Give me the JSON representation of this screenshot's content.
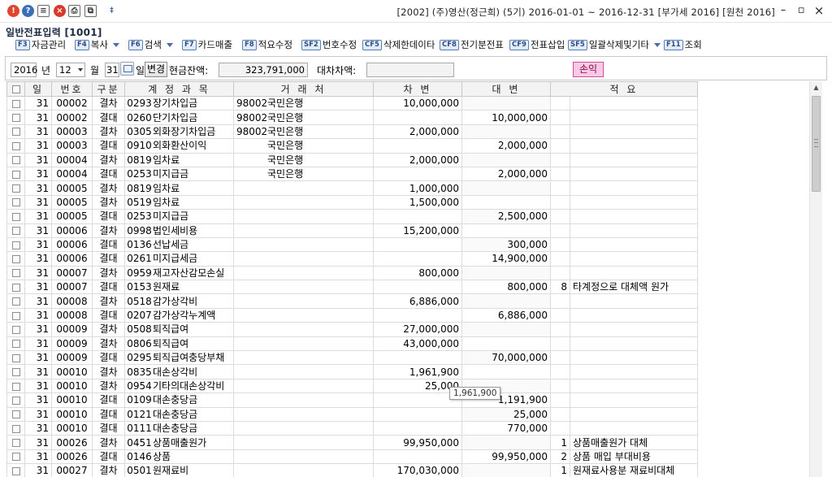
{
  "app": {
    "window_title": "[2002] (주)영산(정근희) (5기) 2016-01-01 ~ 2016-12-31 [부가세 2016] [원천 2016]",
    "form_title": "일반전표입력 [1001]",
    "minimize_symbol": "–",
    "restore_symbol": "▫",
    "close_symbol": "×"
  },
  "titlebar_icons": {
    "alert": "!",
    "help": "?",
    "memo": "≡",
    "close": "×",
    "print": "⎙",
    "copy": "⧉",
    "more": "‡"
  },
  "toolbar": [
    {
      "key": "F3",
      "label": "자금관리",
      "dropdown": false
    },
    {
      "key": "F4",
      "label": "복사",
      "dropdown": true
    },
    {
      "key": "F6",
      "label": "검색",
      "dropdown": true
    },
    {
      "key": "F7",
      "label": "카드매출",
      "dropdown": false
    },
    {
      "key": "F8",
      "label": "적요수정",
      "dropdown": false
    },
    {
      "key": "SF2",
      "label": "번호수정",
      "dropdown": false
    },
    {
      "key": "CF5",
      "label": "삭제한데이타",
      "dropdown": false
    },
    {
      "key": "CF8",
      "label": "전기분전표",
      "dropdown": false
    },
    {
      "key": "CF9",
      "label": "전표삽입",
      "dropdown": false
    },
    {
      "key": "SF5",
      "label": "일괄삭제및기타",
      "dropdown": true
    },
    {
      "key": "F11",
      "label": "조회",
      "dropdown": false
    }
  ],
  "filter": {
    "year": "2016",
    "year_label": "년",
    "month": "12",
    "month_label": "월",
    "day": "31",
    "day_label": "일",
    "change_button": "변경",
    "cash_balance_label": "현금잔액:",
    "cash_balance": "323,791,000",
    "diff_label": "대차차액:",
    "diff_value": "",
    "profit_button": "손익"
  },
  "grid": {
    "columns": [
      "",
      "일",
      "번호",
      "구분",
      "계 정 과 목",
      "거 래 처",
      "차 변",
      "대 변",
      "적 요"
    ],
    "rows": [
      [
        "31",
        "00002",
        "결차",
        "0293",
        "장기차입금",
        "98002",
        "국민은행",
        "10,000,000",
        "",
        "",
        ""
      ],
      [
        "31",
        "00002",
        "결대",
        "0260",
        "단기차입금",
        "98002",
        "국민은행",
        "",
        "10,000,000",
        "",
        ""
      ],
      [
        "31",
        "00003",
        "결차",
        "0305",
        "외화장기차입금",
        "98002",
        "국민은행",
        "2,000,000",
        "",
        "",
        ""
      ],
      [
        "31",
        "00003",
        "결대",
        "0910",
        "외화환산이익",
        "",
        "국민은행",
        "",
        "2,000,000",
        "",
        ""
      ],
      [
        "31",
        "00004",
        "결차",
        "0819",
        "임차료",
        "",
        "국민은행",
        "2,000,000",
        "",
        "",
        ""
      ],
      [
        "31",
        "00004",
        "결대",
        "0253",
        "미지급금",
        "",
        "국민은행",
        "",
        "2,000,000",
        "",
        ""
      ],
      [
        "31",
        "00005",
        "결차",
        "0819",
        "임차료",
        "",
        "",
        "1,000,000",
        "",
        "",
        ""
      ],
      [
        "31",
        "00005",
        "결차",
        "0519",
        "임차료",
        "",
        "",
        "1,500,000",
        "",
        "",
        ""
      ],
      [
        "31",
        "00005",
        "결대",
        "0253",
        "미지급금",
        "",
        "",
        "",
        "2,500,000",
        "",
        ""
      ],
      [
        "31",
        "00006",
        "결차",
        "0998",
        "법인세비용",
        "",
        "",
        "15,200,000",
        "",
        "",
        ""
      ],
      [
        "31",
        "00006",
        "결대",
        "0136",
        "선납세금",
        "",
        "",
        "",
        "300,000",
        "",
        ""
      ],
      [
        "31",
        "00006",
        "결대",
        "0261",
        "미지급세금",
        "",
        "",
        "",
        "14,900,000",
        "",
        ""
      ],
      [
        "31",
        "00007",
        "결차",
        "0959",
        "재고자산감모손실",
        "",
        "",
        "800,000",
        "",
        "",
        ""
      ],
      [
        "31",
        "00007",
        "결대",
        "0153",
        "원재료",
        "",
        "",
        "",
        "800,000",
        "8",
        "타계정으로 대체액 원가"
      ],
      [
        "31",
        "00008",
        "결차",
        "0518",
        "감가상각비",
        "",
        "",
        "6,886,000",
        "",
        "",
        ""
      ],
      [
        "31",
        "00008",
        "결대",
        "0207",
        "감가상각누계액",
        "",
        "",
        "",
        "6,886,000",
        "",
        ""
      ],
      [
        "31",
        "00009",
        "결차",
        "0508",
        "퇴직급여",
        "",
        "",
        "27,000,000",
        "",
        "",
        ""
      ],
      [
        "31",
        "00009",
        "결차",
        "0806",
        "퇴직급여",
        "",
        "",
        "43,000,000",
        "",
        "",
        ""
      ],
      [
        "31",
        "00009",
        "결대",
        "0295",
        "퇴직급여충당부채",
        "",
        "",
        "",
        "70,000,000",
        "",
        ""
      ],
      [
        "31",
        "00010",
        "결차",
        "0835",
        "대손상각비",
        "",
        "",
        "1,961,900",
        "",
        "",
        ""
      ],
      [
        "31",
        "00010",
        "결차",
        "0954",
        "기타의대손상각비",
        "",
        "",
        "25,000",
        "",
        "",
        ""
      ],
      [
        "31",
        "00010",
        "결대",
        "0109",
        "대손충당금",
        "",
        "",
        "",
        "1,191,900",
        "",
        ""
      ],
      [
        "31",
        "00010",
        "결대",
        "0121",
        "대손충당금",
        "",
        "",
        "",
        "25,000",
        "",
        ""
      ],
      [
        "31",
        "00010",
        "결대",
        "0111",
        "대손충당금",
        "",
        "",
        "",
        "770,000",
        "",
        ""
      ],
      [
        "31",
        "00026",
        "결차",
        "0451",
        "상품매출원가",
        "",
        "",
        "99,950,000",
        "",
        "1",
        "상품매출원가 대체"
      ],
      [
        "31",
        "00026",
        "결대",
        "0146",
        "상품",
        "",
        "",
        "",
        "99,950,000",
        "2",
        "상품 매입 부대비용"
      ],
      [
        "31",
        "00027",
        "결차",
        "0501",
        "원재료비",
        "",
        "",
        "170,030,000",
        "",
        "1",
        "원재료사용분 재료비대체"
      ]
    ]
  },
  "tooltip": "1,961,900"
}
